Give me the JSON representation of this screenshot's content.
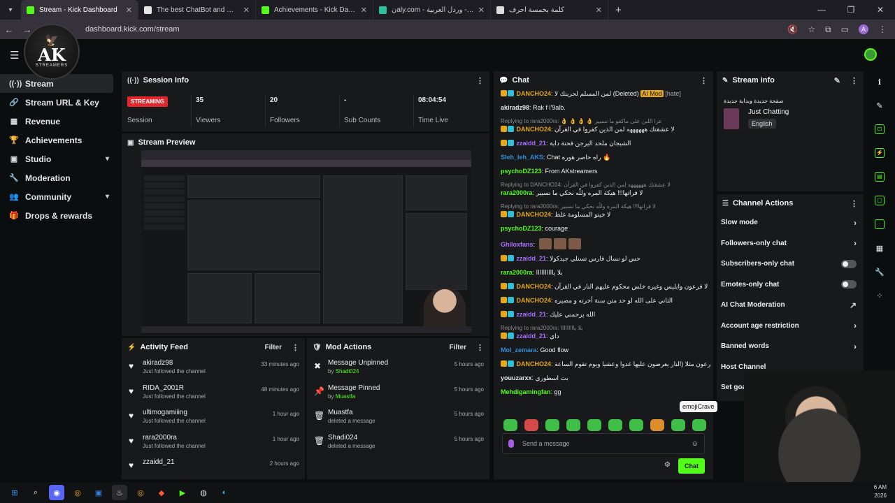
{
  "browser": {
    "tabs": [
      {
        "title": "Stream - Kick Dashboard",
        "fav_color": "#53fc18",
        "active": true
      },
      {
        "title": "The best ChatBot and Widgets",
        "fav_color": "#e6e6e6",
        "active": false
      },
      {
        "title": "Achievements - Kick Dashboard",
        "fav_color": "#53fc18",
        "active": false
      },
      {
        "title": "نaly.com - كلماتي - وردل العربية",
        "fav_color": "#2ec0a0",
        "active": false
      },
      {
        "title": "كلمة بخمسة أحرف",
        "fav_color": "#dddddd",
        "active": false
      }
    ],
    "url": "dashboard.kick.com/stream",
    "profile_initial": "A"
  },
  "logo": {
    "ak": "AK",
    "sub": "STREAMERS"
  },
  "sidebar": {
    "items": [
      {
        "label": "Stream",
        "icon": "stream-icon",
        "glyph": "((·))",
        "active": true,
        "chev": ""
      },
      {
        "label": "Stream URL & Key",
        "icon": "link-icon",
        "glyph": "🔗",
        "chev": ""
      },
      {
        "label": "Revenue",
        "icon": "revenue-icon",
        "glyph": "▦",
        "chev": ""
      },
      {
        "label": "Achievements",
        "icon": "trophy-icon",
        "glyph": "🏆",
        "chev": ""
      },
      {
        "label": "Studio",
        "icon": "studio-icon",
        "glyph": "▣",
        "chev": "▾"
      },
      {
        "label": "Moderation",
        "icon": "wrench-icon",
        "glyph": "🔧",
        "chev": ""
      },
      {
        "label": "Community",
        "icon": "community-icon",
        "glyph": "👥",
        "chev": "▾"
      },
      {
        "label": "Drops & rewards",
        "icon": "gift-icon",
        "glyph": "🎁",
        "chev": ""
      }
    ]
  },
  "session": {
    "title": "Session Info",
    "status": "STREAMING",
    "stats": [
      {
        "value": "",
        "label": "Session",
        "live": true
      },
      {
        "value": "35",
        "label": "Viewers"
      },
      {
        "value": "20",
        "label": "Followers"
      },
      {
        "value": "-",
        "label": "Sub Counts"
      },
      {
        "value": "08:04:54",
        "label": "Time Live"
      }
    ]
  },
  "preview": {
    "title": "Stream Preview"
  },
  "activity": {
    "title": "Activity Feed",
    "filter": "Filter",
    "items": [
      {
        "name": "akiradz98",
        "sub": "Just followed the channel",
        "time": "33 minutes ago"
      },
      {
        "name": "RIDA_2001R",
        "sub": "Just followed the channel",
        "time": "48 minutes ago"
      },
      {
        "name": "ultimogamiiing",
        "sub": "Just followed the channel",
        "time": "1 hour ago"
      },
      {
        "name": "rara2000ra",
        "sub": "Just followed the channel",
        "time": "1 hour ago"
      },
      {
        "name": "zzaidd_21",
        "sub": "",
        "time": "2 hours ago"
      }
    ]
  },
  "mod": {
    "title": "Mod Actions",
    "filter": "Filter",
    "items": [
      {
        "name": "Message Unpinned",
        "by": "by",
        "who": "Shadi024",
        "time": "5 hours ago",
        "glyph": "✖"
      },
      {
        "name": "Message Pinned",
        "by": "by",
        "who": "Muastfa",
        "time": "5 hours ago",
        "glyph": "📌"
      },
      {
        "name": "Muastfa",
        "by": "deleted a message",
        "who": "",
        "time": "5 hours ago",
        "glyph": "🗑"
      },
      {
        "name": "Shadi024",
        "by": "deleted a message",
        "who": "",
        "time": "5 hours ago",
        "glyph": "🗑"
      }
    ]
  },
  "chat": {
    "title": "Chat",
    "messages": [
      {
        "reply": "",
        "user": "DANCHO24",
        "color": "#e3a81c",
        "badges": true,
        "text": "لمن المسلم لحريتك لا (Deleted) ",
        "mod": "AI Mod",
        "tail": " [hate]"
      },
      {
        "reply": "",
        "user": "akiradz98",
        "color": "#e6e6e6",
        "badges": false,
        "text": "Rak f l'9alb.",
        "mod": "",
        "tail": ""
      },
      {
        "reply": "Replying to rara2000ra: 👌 👌 👌 👌 عزا اللبن على ماكفو ما نسيير",
        "user": "DANCHO24",
        "color": "#e3a81c",
        "badges": true,
        "text": "لا عشقتك ههههههه لمن الذين كفروا في القرآن",
        "mod": "",
        "tail": ""
      },
      {
        "reply": "",
        "user": "zzaidd_21",
        "color": "#a970ff",
        "badges": true,
        "text": "الشيجان ملحد اليرجن فحنة داية",
        "mod": "",
        "tail": ""
      },
      {
        "reply": "",
        "user": "Sleh_leh_AKS",
        "color": "#2e8fd8",
        "badges": false,
        "text": "Chat راه حاصر هوره 🔥",
        "mod": "",
        "tail": ""
      },
      {
        "reply": "",
        "user": "psychoDZ123",
        "color": "#53fc18",
        "badges": false,
        "text": "From AKstreamers",
        "mod": "",
        "tail": ""
      },
      {
        "reply": "Replying to DANCHO24: لا عشقتك ههههههه لمن الذين كفروا في القرآن",
        "user": "rara2000ra",
        "color": "#53fc18",
        "badges": false,
        "text": "لا فراتها!!! هيكة المره وللّه نحكي ما نسيير",
        "mod": "",
        "tail": ""
      },
      {
        "reply": "Replying to rara2000ra: لا فراتها!!! هيكة المره وللّه نحكي ما نسيير",
        "user": "DANCHO24",
        "color": "#e3a81c",
        "badges": true,
        "text": "لا خيتو المسلومة غلط",
        "mod": "",
        "tail": ""
      },
      {
        "reply": "",
        "user": "psychoDZ123",
        "color": "#53fc18",
        "badges": false,
        "text": "courage",
        "mod": "",
        "tail": ""
      },
      {
        "reply": "",
        "user": "Ghiloxfans",
        "color": "#a970ff",
        "badges": false,
        "text": "",
        "mod": "",
        "tail": "",
        "emotes": 3
      },
      {
        "reply": "",
        "user": "zzaidd_21",
        "color": "#a970ff",
        "badges": true,
        "text": "حس لو نسال فارس تسنلي جيدكولا",
        "mod": "",
        "tail": ""
      },
      {
        "reply": "",
        "user": "rara2000ra",
        "color": "#53fc18",
        "badges": false,
        "text": "بلا ياااااااااا",
        "mod": "",
        "tail": ""
      },
      {
        "reply": "",
        "user": "DANCHO24",
        "color": "#e3a81c",
        "badges": true,
        "text": "لا فرعون وابليس وغيره خلس محكوم عليهم النار في القرآن",
        "mod": "",
        "tail": ""
      },
      {
        "reply": "",
        "user": "DANCHO24",
        "color": "#e3a81c",
        "badges": true,
        "text": "الثاني على الله لو حد متن سنة أخرته و مصيره",
        "mod": "",
        "tail": ""
      },
      {
        "reply": "",
        "user": "zzaidd_21",
        "color": "#a970ff",
        "badges": true,
        "text": "الله يرحمني عليك",
        "mod": "",
        "tail": ""
      },
      {
        "reply": "Replying to rara2000ra: بلا يااااااااا",
        "user": "zzaidd_21",
        "color": "#a970ff",
        "badges": true,
        "text": "داي",
        "mod": "",
        "tail": ""
      },
      {
        "reply": "",
        "user": "Mol_zemara",
        "color": "#2e8fd8",
        "badges": false,
        "text": "Good flow",
        "mod": "",
        "tail": ""
      },
      {
        "reply": "",
        "user": "DANCHO24",
        "color": "#e3a81c",
        "badges": true,
        "text": "فرعون مثلا (النار يعرضون عليها غدوا وعشيا ويوم تقوم الساعة",
        "mod": "",
        "tail": ""
      },
      {
        "reply": "",
        "user": "youuzarxx",
        "color": "#e6e6e6",
        "badges": false,
        "text": "بت اسطوري",
        "mod": "",
        "tail": ""
      },
      {
        "reply": "",
        "user": "Mehdigamingfan",
        "color": "#53fc18",
        "badges": false,
        "text": "gg",
        "mod": "",
        "tail": ""
      }
    ],
    "tooltip": "emojiCrave",
    "input_placeholder": "Send a message",
    "send_label": "Chat"
  },
  "stream_info": {
    "title": "Stream info",
    "stream_title": "صفحة جديدة وبداية جديدة",
    "category": "Just Chatting",
    "language": "English"
  },
  "channel_actions": {
    "title": "Channel Actions",
    "items": [
      {
        "label": "Slow mode",
        "kind": "arrow"
      },
      {
        "label": "Followers-only chat",
        "kind": "arrow"
      },
      {
        "label": "Subscribers-only chat",
        "kind": "toggle"
      },
      {
        "label": "Emotes-only chat",
        "kind": "toggle"
      },
      {
        "label": "AI Chat Moderation",
        "kind": "link"
      },
      {
        "label": "Account age restriction",
        "kind": "arrow"
      },
      {
        "label": "Banned words",
        "kind": "arrow"
      },
      {
        "label": "Host Channel",
        "kind": "none"
      },
      {
        "label": "Set goals",
        "kind": "arrow"
      }
    ]
  },
  "clock": {
    "time": "6 AM",
    "year": "2026"
  }
}
